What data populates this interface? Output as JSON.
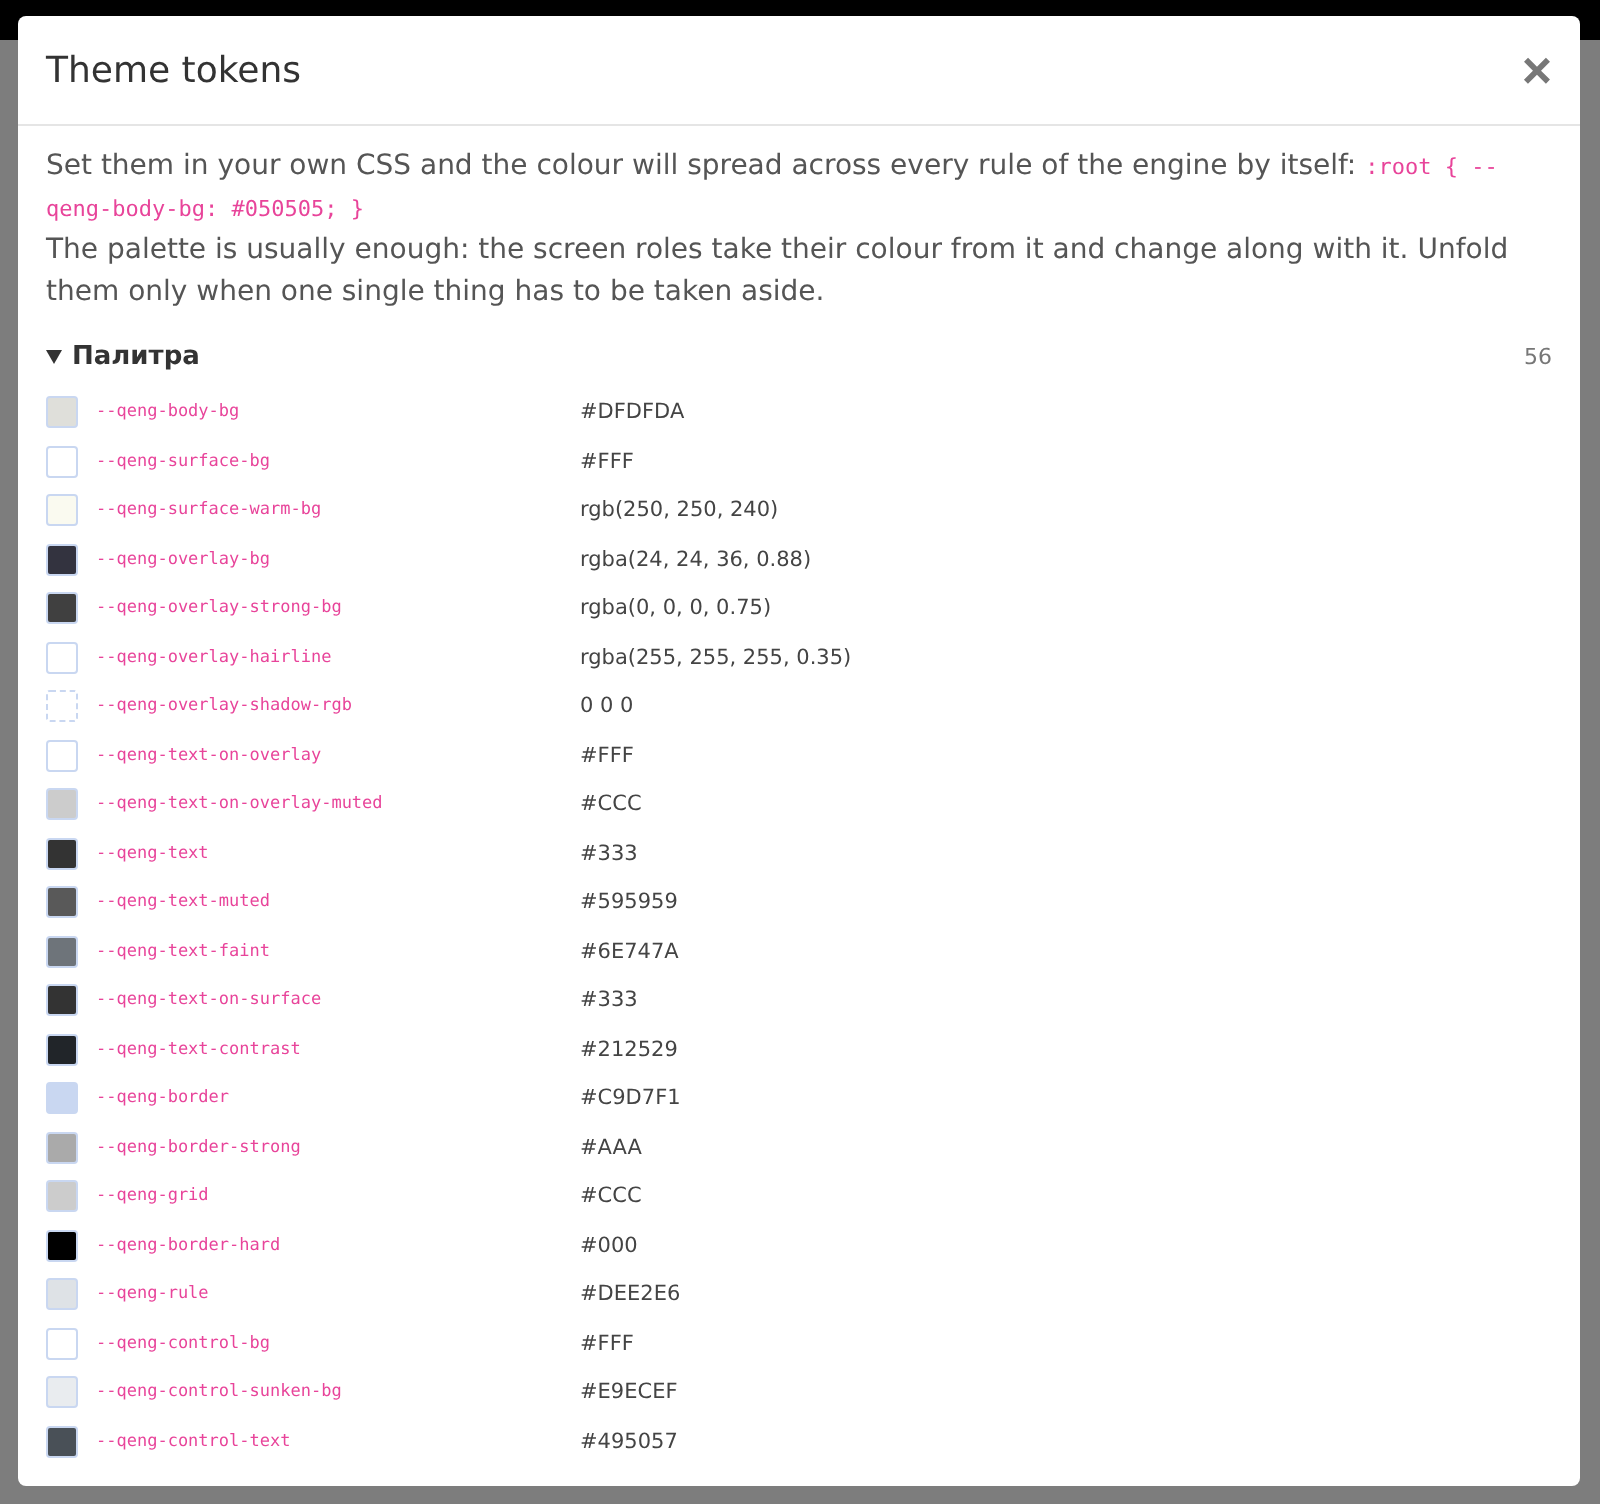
{
  "dialog": {
    "title": "Theme tokens",
    "close": "×",
    "intro": "Set them in your own CSS and the colour will spread across every rule of the engine by itself:",
    "intro_code": ":root { --qeng-body-bg: #050505; }",
    "note": "The palette is usually enough: the screen roles take their colour from it and change along with it. Unfold them only when one single thing has to be taken aside.",
    "section": {
      "title": "Палитра",
      "expanded": true,
      "count": "56",
      "tokens": [
        {
          "name": "--qeng-body-bg",
          "value": "#DFDFDA",
          "kind": "swatch",
          "color": "#dfdfda"
        },
        {
          "name": "--qeng-surface-bg",
          "value": "#FFF",
          "kind": "swatch",
          "color": "#ffffff"
        },
        {
          "name": "--qeng-surface-warm-bg",
          "value": "rgb(250, 250, 240)",
          "kind": "swatch",
          "color": "#fafaf0"
        },
        {
          "name": "--qeng-overlay-bg",
          "value": "rgba(24, 24, 36, 0.88)",
          "kind": "swatch",
          "color": "#33333f"
        },
        {
          "name": "--qeng-overlay-strong-bg",
          "value": "rgba(0, 0, 0, 0.75)",
          "kind": "swatch",
          "color": "#404040"
        },
        {
          "name": "--qeng-overlay-hairline",
          "value": "rgba(255, 255, 255, 0.35)",
          "kind": "swatch",
          "color": "#ffffff"
        },
        {
          "name": "--qeng-overlay-shadow-rgb",
          "value": "0 0 0",
          "kind": "empty"
        },
        {
          "name": "--qeng-text-on-overlay",
          "value": "#FFF",
          "kind": "swatch",
          "color": "#ffffff"
        },
        {
          "name": "--qeng-text-on-overlay-muted",
          "value": "#CCC",
          "kind": "swatch",
          "color": "#cccccc"
        },
        {
          "name": "--qeng-text",
          "value": "#333",
          "kind": "swatch",
          "color": "#333333"
        },
        {
          "name": "--qeng-text-muted",
          "value": "#595959",
          "kind": "swatch",
          "color": "#595959"
        },
        {
          "name": "--qeng-text-faint",
          "value": "#6E747A",
          "kind": "swatch",
          "color": "#6e747a"
        },
        {
          "name": "--qeng-text-on-surface",
          "value": "#333",
          "kind": "swatch",
          "color": "#333333"
        },
        {
          "name": "--qeng-text-contrast",
          "value": "#212529",
          "kind": "swatch",
          "color": "#212529"
        },
        {
          "name": "--qeng-border",
          "value": "#C9D7F1",
          "kind": "swatch",
          "color": "#c9d7f1"
        },
        {
          "name": "--qeng-border-strong",
          "value": "#AAA",
          "kind": "swatch",
          "color": "#aaaaaa"
        },
        {
          "name": "--qeng-grid",
          "value": "#CCC",
          "kind": "swatch",
          "color": "#cccccc"
        },
        {
          "name": "--qeng-border-hard",
          "value": "#000",
          "kind": "swatch",
          "color": "#000000"
        },
        {
          "name": "--qeng-rule",
          "value": "#DEE2E6",
          "kind": "swatch",
          "color": "#dee2e6"
        },
        {
          "name": "--qeng-control-bg",
          "value": "#FFF",
          "kind": "swatch",
          "color": "#ffffff"
        },
        {
          "name": "--qeng-control-sunken-bg",
          "value": "#E9ECEF",
          "kind": "swatch",
          "color": "#e9ecef"
        },
        {
          "name": "--qeng-control-text",
          "value": "#495057",
          "kind": "swatch",
          "color": "#495057"
        }
      ]
    }
  }
}
